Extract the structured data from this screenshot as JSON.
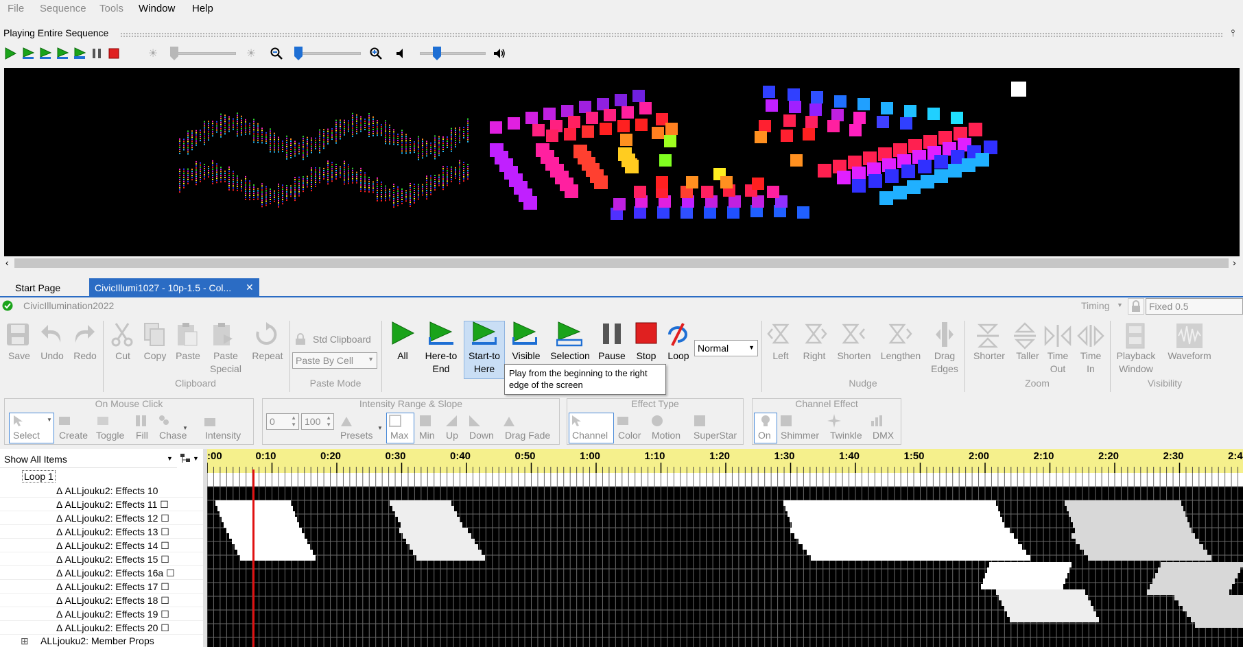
{
  "menu": {
    "file": "File",
    "sequence": "Sequence",
    "tools": "Tools",
    "window": "Window",
    "help": "Help"
  },
  "preview": {
    "title": "Playing Entire Sequence",
    "pin": "📌"
  },
  "transport_icons": [
    "play-icon",
    "play-here-to-end-icon",
    "play-start-to-here-icon",
    "play-visible-icon",
    "play-selection-icon",
    "pause-icon",
    "stop-icon",
    "brightness-low-icon",
    "brightness-high-icon",
    "zoom-out-icon",
    "zoom-in-icon",
    "volume-mute-icon",
    "volume-loud-icon"
  ],
  "sliders": {
    "brightness": 0.0,
    "zoom": 0.0,
    "volume": 0.1
  },
  "tabs": {
    "start": "Start Page",
    "active": "CivicIllumi1027 - 10p-1.5 - Col...",
    "close": "✕"
  },
  "ribbon": {
    "sequence_name": "CivicIllumination2022",
    "file": {
      "save": "Save",
      "undo": "Undo",
      "redo": "Redo"
    },
    "clipboard": {
      "title": "Clipboard",
      "cut": "Cut",
      "copy": "Copy",
      "paste": "Paste",
      "paste_special_1": "Paste",
      "paste_special_2": "Special",
      "repeat": "Repeat"
    },
    "paste_mode": {
      "title": "Paste Mode",
      "std": "Std Clipboard",
      "mode": "Paste By Cell"
    },
    "play": {
      "all": "All",
      "here_1": "Here-to",
      "here_2": "End",
      "start_1": "Start-to",
      "start_2": "Here",
      "visible": "Visible",
      "selection": "Selection",
      "pause": "Pause",
      "stop": "Stop",
      "loop": "Loop",
      "speed": "Normal"
    },
    "nudge": {
      "title": "Nudge",
      "left": "Left",
      "right": "Right",
      "shorten": "Shorten",
      "lengthen": "Lengthen",
      "drag_1": "Drag",
      "drag_2": "Edges"
    },
    "zoom": {
      "title": "Zoom",
      "shorter": "Shorter",
      "taller": "Taller",
      "timeout_1": "Time",
      "timeout_2": "Out",
      "timein_1": "Time",
      "timein_2": "In"
    },
    "visibility": {
      "title": "Visibility",
      "pw_1": "Playback",
      "pw_2": "Window",
      "waveform": "Waveform"
    },
    "timing": {
      "label": "Timing",
      "value": "Fixed 0.5"
    }
  },
  "tooltip": {
    "line1": "Play from the beginning to the right",
    "line2": "edge of the screen"
  },
  "tools": {
    "mouse": {
      "title": "On Mouse Click",
      "select": "Select",
      "create": "Create",
      "toggle": "Toggle",
      "fill": "Fill",
      "chase": "Chase",
      "intensity": "Intensity"
    },
    "intensity": {
      "title": "Intensity Range & Slope",
      "min_val": "0",
      "max_val": "100",
      "presets": "Presets",
      "max": "Max",
      "min": "Min",
      "up": "Up",
      "down": "Down",
      "drag_fade": "Drag Fade"
    },
    "effect_type": {
      "title": "Effect Type",
      "channel": "Channel",
      "color": "Color",
      "motion": "Motion",
      "superstar": "SuperStar"
    },
    "channel_effect": {
      "title": "Channel Effect",
      "on": "On",
      "shimmer": "Shimmer",
      "twinkle": "Twinkle",
      "dmx": "DMX"
    }
  },
  "tree": {
    "filter": "Show All Items",
    "loop": "Loop 1",
    "items": [
      "Δ ALLjouku2: Effects 10",
      "Δ ALLjouku2: Effects 11 ☐",
      "Δ ALLjouku2: Effects 12 ☐",
      "Δ ALLjouku2: Effects 13 ☐",
      "Δ ALLjouku2: Effects 14 ☐",
      "Δ ALLjouku2: Effects 15 ☐",
      "Δ ALLjouku2: Effects 16a ☐",
      "Δ ALLjouku2: Effects 17 ☐",
      "Δ ALLjouku2: Effects 18 ☐",
      "Δ ALLjouku2: Effects 19 ☐",
      "Δ ALLjouku2: Effects 20 ☐"
    ],
    "member": "ALLjouku2: Member Props",
    "expand": "⊞"
  },
  "ruler": {
    "labels": [
      ":00",
      "0:10",
      "0:20",
      "0:30",
      "0:40",
      "0:50",
      "1:00",
      "1:10",
      "1:20",
      "1:30",
      "1:40",
      "1:50",
      "2:00",
      "2:10",
      "2:20",
      "2:30",
      "2:4"
    ]
  },
  "colors": {
    "accent": "#2b6cc4",
    "play_green": "#1aa31a",
    "ruler": "#f5f08c",
    "playhead": "#e01010"
  }
}
